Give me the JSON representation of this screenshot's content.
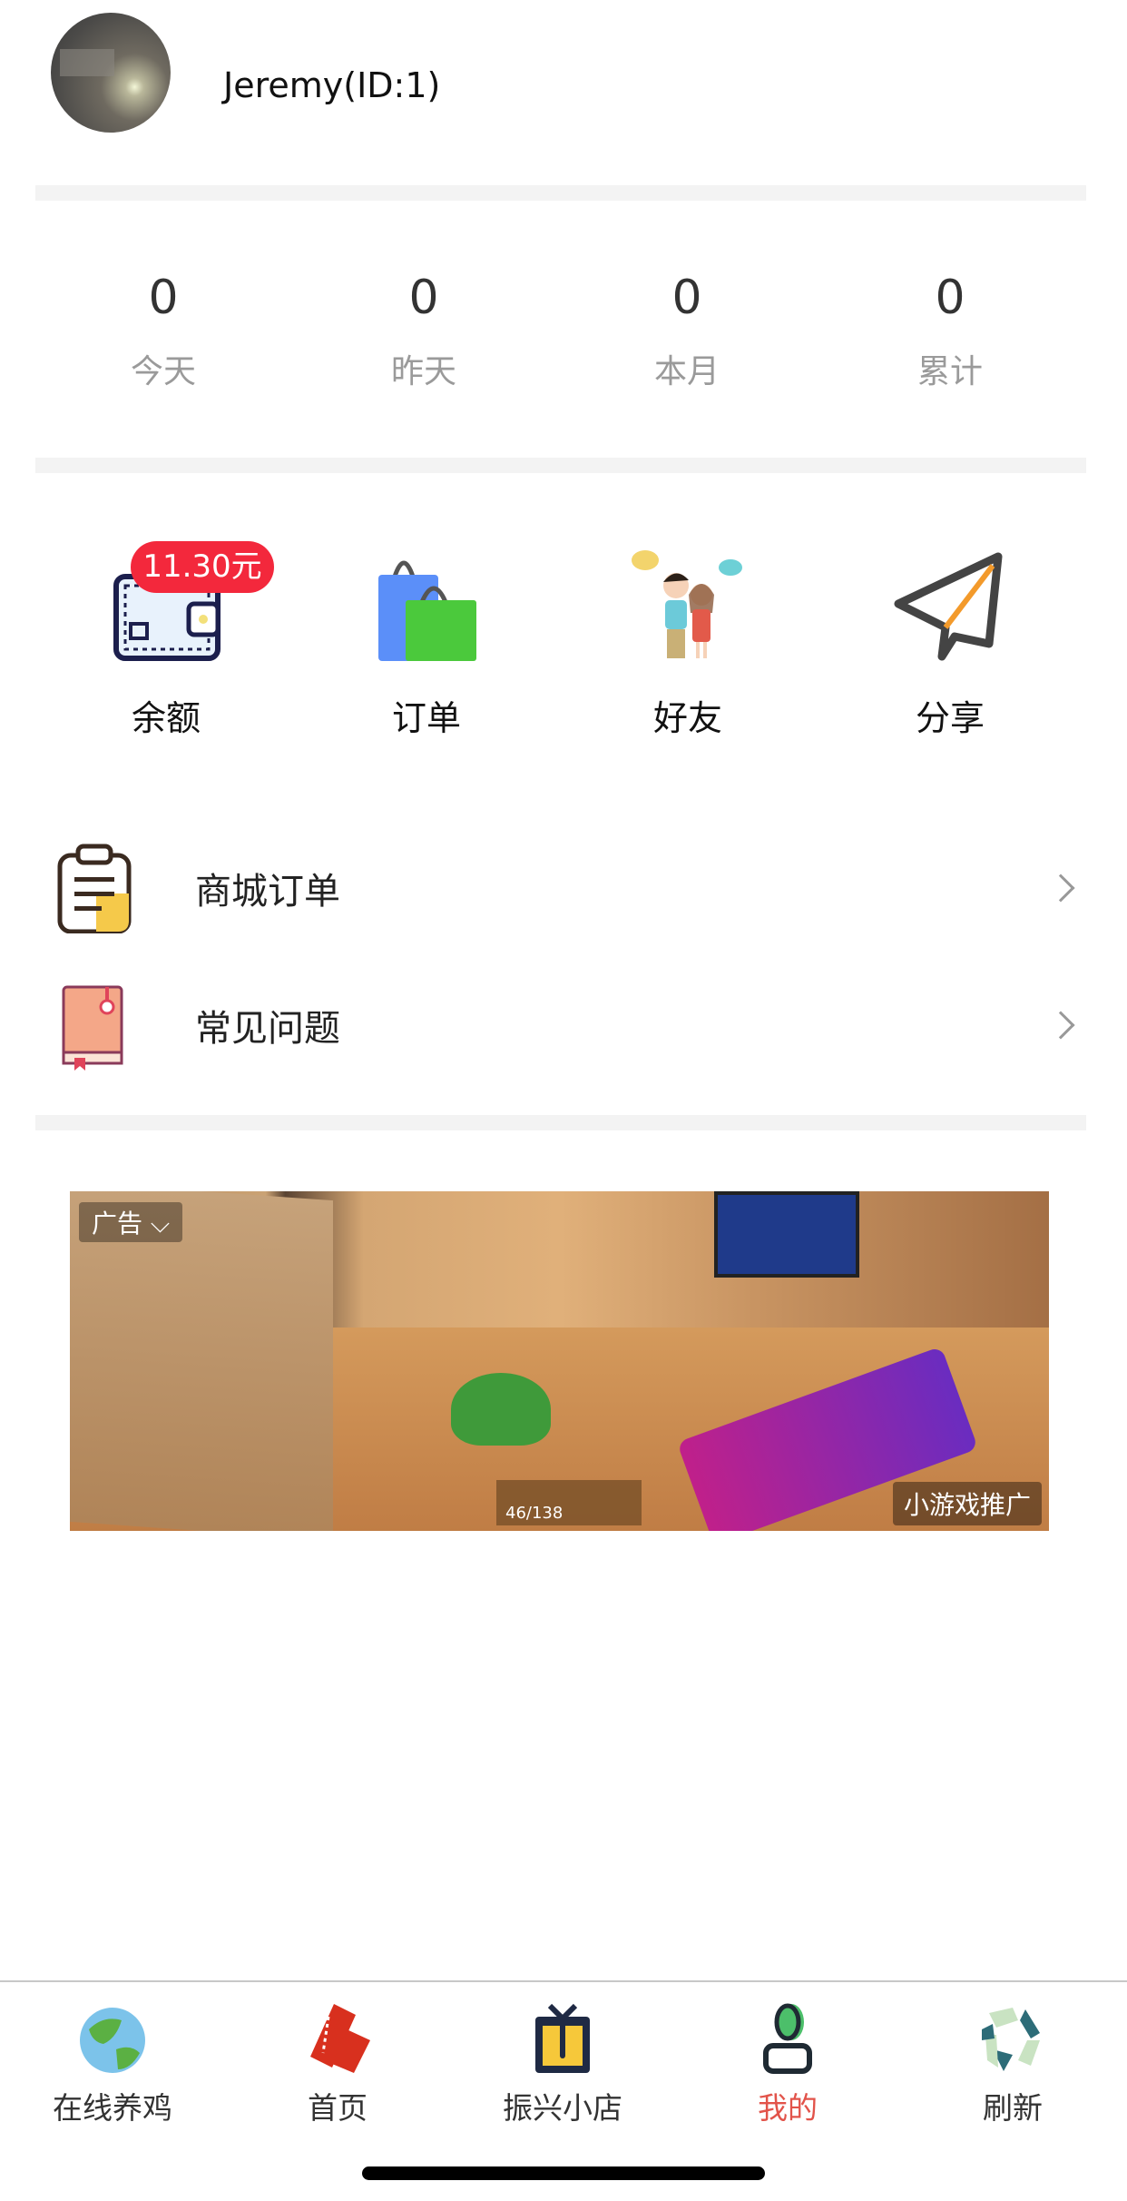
{
  "profile": {
    "name": "Jeremy(ID:1)"
  },
  "stats": [
    {
      "value": "0",
      "label": "今天"
    },
    {
      "value": "0",
      "label": "昨天"
    },
    {
      "value": "0",
      "label": "本月"
    },
    {
      "value": "0",
      "label": "累计"
    }
  ],
  "features": [
    {
      "label": "余额",
      "icon": "wallet-icon",
      "badge": "11.30元"
    },
    {
      "label": "订单",
      "icon": "shopping-bag-icon"
    },
    {
      "label": "好友",
      "icon": "friends-icon"
    },
    {
      "label": "分享",
      "icon": "paper-plane-icon"
    }
  ],
  "menu": [
    {
      "label": "商城订单",
      "icon": "clipboard-icon"
    },
    {
      "label": "常见问题",
      "icon": "book-icon"
    }
  ],
  "ad": {
    "tag": "广告",
    "source": "小游戏推广",
    "hud_ammo": "46/138"
  },
  "tabbar": [
    {
      "label": "在线养鸡",
      "icon": "globe-icon"
    },
    {
      "label": "首页",
      "icon": "ticket-icon"
    },
    {
      "label": "振兴小店",
      "icon": "tv-shop-icon"
    },
    {
      "label": "我的",
      "icon": "user-icon",
      "active": true
    },
    {
      "label": "刷新",
      "icon": "recycle-icon"
    }
  ],
  "colors": {
    "badge": "#f3283c",
    "active_tab": "#e2534a"
  }
}
